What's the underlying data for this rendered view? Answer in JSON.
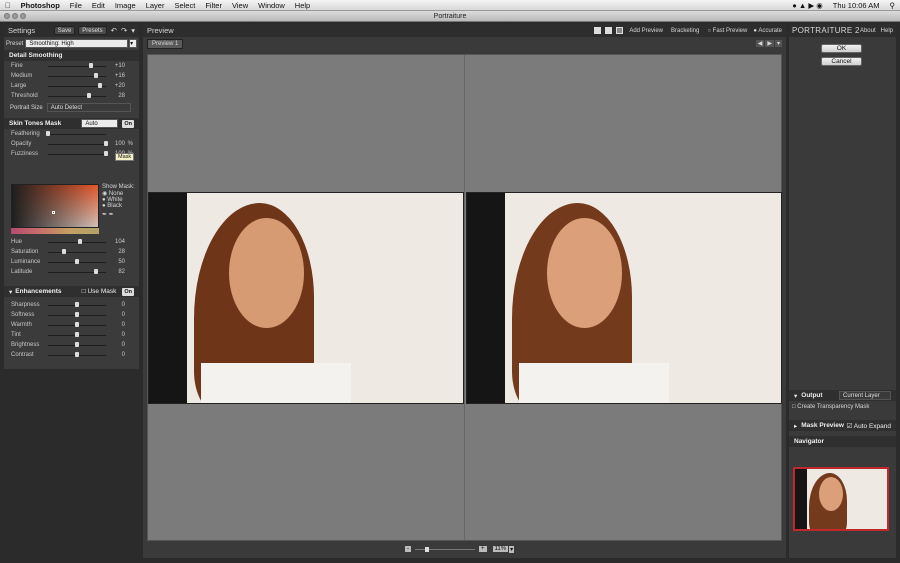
{
  "menubar": {
    "app": "Photoshop",
    "items": [
      "File",
      "Edit",
      "Image",
      "Layer",
      "Select",
      "Filter",
      "View",
      "Window",
      "Help"
    ],
    "clock": "Thu 10:06 AM"
  },
  "window_title": "Portraiture",
  "left": {
    "title": "Settings",
    "save": "Save",
    "presets": "Presets",
    "preset_label": "Preset",
    "preset_value": "Smoothing: High",
    "detail": {
      "title": "Detail Smoothing",
      "sliders": [
        {
          "label": "Fine",
          "value": "+10",
          "pos": 0.74
        },
        {
          "label": "Medium",
          "value": "+16",
          "pos": 0.82
        },
        {
          "label": "Large",
          "value": "+20",
          "pos": 0.9
        },
        {
          "label": "Threshold",
          "value": "28",
          "pos": 0.7
        }
      ],
      "portrait_size_label": "Portrait Size",
      "portrait_size_value": "Auto Detect"
    },
    "skin": {
      "title": "Skin Tones Mask",
      "mode": "Auto",
      "on": "On",
      "mask_btn": "Mask",
      "sliders": [
        {
          "label": "Feathering",
          "value": "",
          "pos": 0.0
        },
        {
          "label": "Opacity",
          "value": "100",
          "unit": "%",
          "pos": 1.0
        },
        {
          "label": "Fuzziness",
          "value": "100",
          "unit": "%",
          "pos": 1.0
        }
      ],
      "show_mask_label": "Show Mask:",
      "show_mask_options": [
        "None",
        "White",
        "Black"
      ],
      "hsl": [
        {
          "label": "Hue",
          "value": "104",
          "pos": 0.55
        },
        {
          "label": "Saturation",
          "value": "28",
          "pos": 0.28
        },
        {
          "label": "Luminance",
          "value": "50",
          "pos": 0.5
        },
        {
          "label": "Latitude",
          "value": "82",
          "pos": 0.82
        }
      ]
    },
    "enh": {
      "title": "Enhancements",
      "use_mask": "Use Mask",
      "on": "On",
      "sliders": [
        {
          "label": "Sharpness",
          "value": "0",
          "pos": 0.5
        },
        {
          "label": "Softness",
          "value": "0",
          "pos": 0.5
        },
        {
          "label": "Warmth",
          "value": "0",
          "pos": 0.5
        },
        {
          "label": "Tint",
          "value": "0",
          "pos": 0.5
        },
        {
          "label": "Brightness",
          "value": "0",
          "pos": 0.5
        },
        {
          "label": "Contrast",
          "value": "0",
          "pos": 0.5
        }
      ]
    }
  },
  "preview": {
    "title": "Preview",
    "add_preview": "Add Preview",
    "bracketing": "Bracketing",
    "fast_preview": "Fast Preview",
    "accurate": "Accurate",
    "tab": "Preview 1",
    "zoom": "11%"
  },
  "right": {
    "logo": "PORTRAITURE 2",
    "about": "About",
    "help": "Help",
    "ok": "OK",
    "cancel": "Cancel",
    "output": {
      "title": "Output",
      "value": "Current Layer",
      "transparency": "Create Transparency Mask"
    },
    "mask_preview": {
      "title": "Mask Preview",
      "auto_expand": "Auto Expand"
    },
    "navigator": "Navigator"
  }
}
